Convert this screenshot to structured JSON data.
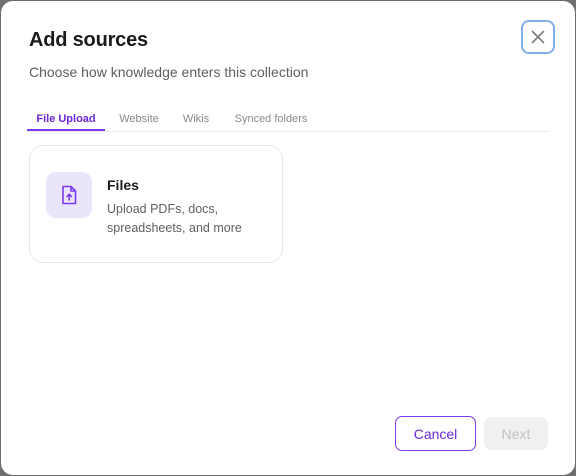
{
  "dialog": {
    "title": "Add sources",
    "subtitle": "Choose how knowledge enters this collection",
    "close_icon": "close-icon"
  },
  "tabs": [
    {
      "label": "File Upload",
      "active": true
    },
    {
      "label": "Website",
      "active": false
    },
    {
      "label": "Wikis",
      "active": false
    },
    {
      "label": "Synced folders",
      "active": false
    }
  ],
  "card": {
    "icon": "file-upload-icon",
    "title": "Files",
    "description": "Upload PDFs, docs, spreadsheets, and more"
  },
  "footer": {
    "cancel_label": "Cancel",
    "next_label": "Next",
    "next_disabled": true
  },
  "colors": {
    "accent": "#7c3aed",
    "accent_text": "#6d28d9",
    "icon_bg": "#ebe5fb",
    "focus_ring": "#7fb1e6"
  }
}
